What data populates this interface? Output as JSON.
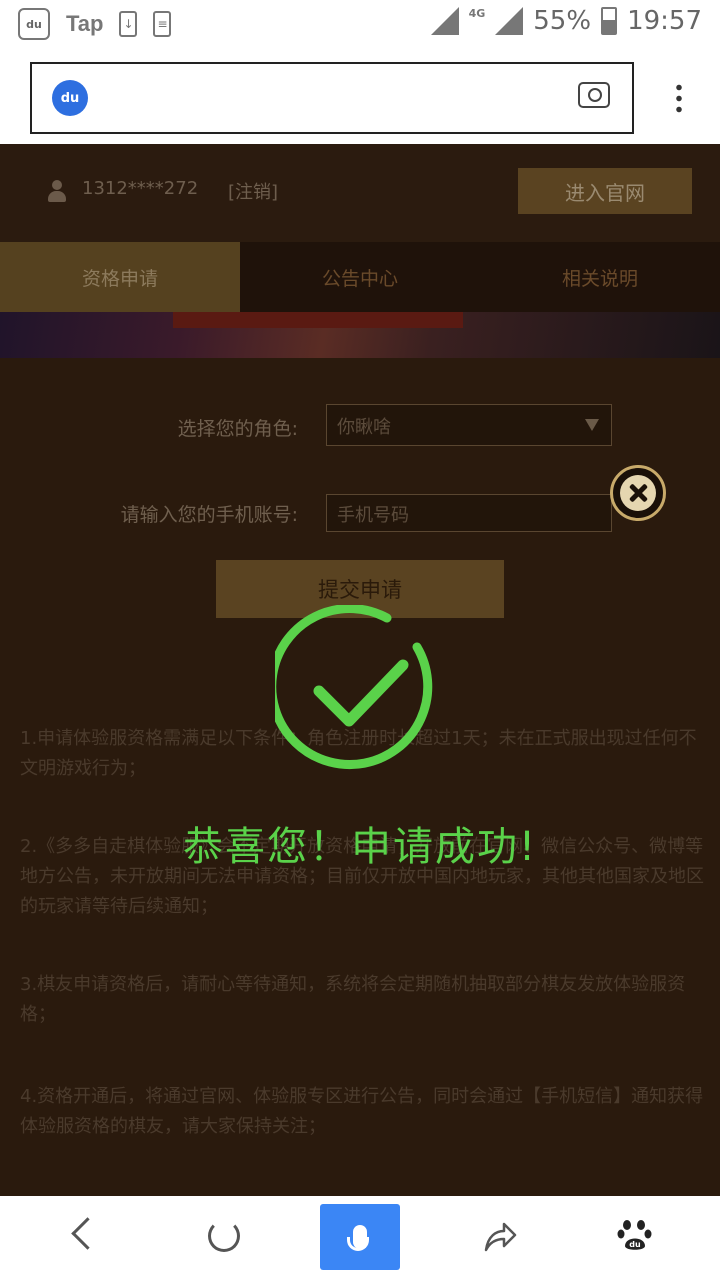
{
  "status_bar": {
    "app_name": "Tap",
    "network": "4G",
    "battery": "55%",
    "time": "19:57",
    "icons": [
      "baidu-app-icon",
      "download-icon",
      "document-icon",
      "signal-icon",
      "network-icon",
      "battery-icon"
    ]
  },
  "browser": {
    "logo_text": "du",
    "icons": [
      "baidu-paw-icon",
      "camera-icon",
      "more-menu-icon"
    ]
  },
  "header": {
    "user_id": "1312****272",
    "logout": "[注销]",
    "official_site_button": "进入官网"
  },
  "tabs": [
    {
      "label": "资格申请",
      "active": true
    },
    {
      "label": "公告中心",
      "active": false
    },
    {
      "label": "相关说明",
      "active": false
    }
  ],
  "form": {
    "role_label": "选择您的角色:",
    "role_value": "你瞅啥",
    "phone_label": "请输入您的手机账号:",
    "phone_placeholder": "手机号码",
    "submit_button": "提交申请"
  },
  "rules": [
    "1.申请体验服资格需满足以下条件：角色注册时长超过1天；未在正式服出现过任何不文明游戏行为；",
    "2.《多多自走棋体验服》会不定期开放资格申请，开放前在官网、微信公众号、微博等地方公告，未开放期间无法申请资格；目前仅开放中国内地玩家，其他其他国家及地区的玩家请等待后续通知；",
    "3.棋友申请资格后，请耐心等待通知，系统将会定期随机抽取部分棋友发放体验服资格；",
    "4.资格开通后，将通过官网、体验服专区进行公告，同时会通过【手机短信】通知获得体验服资格的棋友，请大家保持关注；"
  ],
  "modal": {
    "message": "恭喜您！申请成功!",
    "accent_color": "#5ad24a",
    "icons": [
      "close-icon",
      "success-check-icon"
    ]
  },
  "bottom_nav": {
    "logo_text": "du",
    "icons": [
      "back-icon",
      "refresh-icon",
      "microphone-icon",
      "share-icon",
      "baidu-paw-icon"
    ]
  }
}
